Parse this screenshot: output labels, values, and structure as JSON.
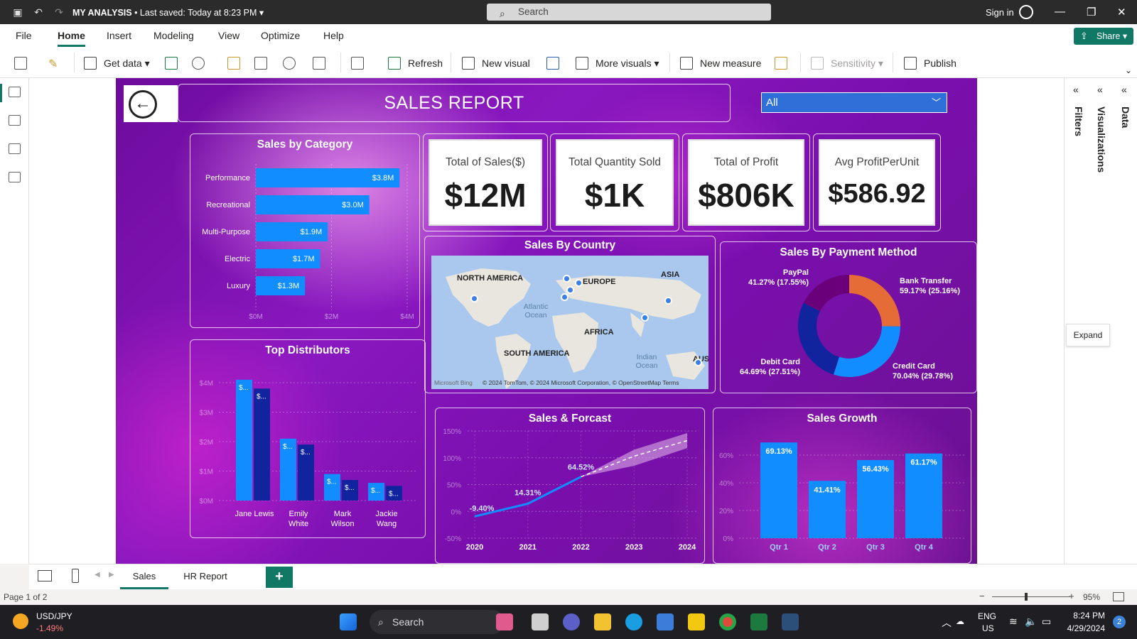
{
  "titlebar": {
    "doc_name": "MY ANALYSIS",
    "saved": "• Last saved: Today at 8:23 PM",
    "search_placeholder": "Search",
    "signin": "Sign in"
  },
  "menu": [
    "File",
    "Home",
    "Insert",
    "Modeling",
    "View",
    "Optimize",
    "Help"
  ],
  "share_label": "Share",
  "toolbar": {
    "get_data": "Get data",
    "refresh": "Refresh",
    "new_visual": "New visual",
    "more_visuals": "More visuals",
    "new_measure": "New measure",
    "sensitivity": "Sensitivity",
    "publish": "Publish"
  },
  "report": {
    "title": "SALES REPORT",
    "slicer_value": "All",
    "kpis": [
      {
        "label": "Total of Sales($)",
        "value": "$12M"
      },
      {
        "label": "Total Quantity Sold",
        "value": "$1K"
      },
      {
        "label": "Total of Profit",
        "value": "$806K"
      },
      {
        "label": "Avg ProfitPerUnit",
        "value": "$586.92"
      }
    ],
    "country_title": "Sales By Country",
    "map_labels": {
      "north_america": "NORTH AMERICA",
      "europe": "EUROPE",
      "asia": "ASIA",
      "africa": "AFRICA",
      "south_america": "SOUTH AMERICA",
      "australia": "AUS",
      "atlantic": "Atlantic Ocean",
      "indian": "Indian Ocean",
      "footer": "© 2024 TomTom, © 2024 Microsoft Corporation, © OpenStreetMap  Terms",
      "bing": "Microsoft Bing"
    }
  },
  "chart_data": [
    {
      "type": "bar",
      "title": "Sales by Category",
      "orientation": "horizontal",
      "categories": [
        "Performance",
        "Recreational",
        "Multi-Purpose",
        "Electric",
        "Luxury"
      ],
      "values": [
        3.8,
        3.0,
        1.9,
        1.7,
        1.3
      ],
      "data_labels": [
        "$3.8M",
        "$3.0M",
        "$1.9M",
        "$1.7M",
        "$1.3M"
      ],
      "xticks": [
        "$0M",
        "$2M",
        "$4M"
      ],
      "xlim": [
        0,
        4
      ],
      "color": "#118dff"
    },
    {
      "type": "bar",
      "title": "Top Distributors",
      "categories": [
        "Jane Lewis",
        "Emily White",
        "Mark Wilson",
        "Jackie Wang"
      ],
      "series": [
        {
          "values": [
            4.1,
            2.1,
            0.9,
            0.6
          ],
          "color": "#118dff"
        },
        {
          "values": [
            3.8,
            1.9,
            0.7,
            0.5
          ],
          "color": "#12239e"
        }
      ],
      "yticks": [
        "$0M",
        "$1M",
        "$2M",
        "$3M",
        "$4M"
      ],
      "ylim": [
        0,
        4
      ],
      "data_label": "$..."
    },
    {
      "type": "pie",
      "title": "Sales By Payment Method",
      "slices": [
        {
          "name": "Bank Transfer",
          "label": "59.17% (25.16%)",
          "value": 25.16,
          "color": "#e66c37"
        },
        {
          "name": "Credit Card",
          "label": "70.04% (29.78%)",
          "value": 29.78,
          "color": "#118dff"
        },
        {
          "name": "Debit Card",
          "label": "64.69% (27.51%)",
          "value": 27.51,
          "color": "#12239e"
        },
        {
          "name": "PayPal",
          "label": "41.27% (17.55%)",
          "value": 17.55,
          "color": "#6b007b"
        }
      ]
    },
    {
      "type": "line",
      "title": "Sales & Forcast",
      "x": [
        "2020",
        "2021",
        "2022",
        "2023",
        "2024"
      ],
      "values": [
        -9.4,
        14.31,
        64.52
      ],
      "data_labels": [
        "-9.40%",
        "14.31%",
        "64.52%"
      ],
      "forecast": [
        64.52,
        103,
        132
      ],
      "yticks": [
        "-50%",
        "0%",
        "50%",
        "100%",
        "150%"
      ],
      "ylim": [
        -50,
        150
      ],
      "color": "#118dff"
    },
    {
      "type": "bar",
      "title": "Sales Growth",
      "categories": [
        "Qtr 1",
        "Qtr 2",
        "Qtr 3",
        "Qtr 4"
      ],
      "values": [
        69.13,
        41.41,
        56.43,
        61.17
      ],
      "data_labels": [
        "69.13%",
        "41.41%",
        "56.43%",
        "61.17%"
      ],
      "yticks": [
        "0%",
        "20%",
        "40%",
        "60%"
      ],
      "ylim": [
        0,
        80
      ],
      "color": "#118dff"
    }
  ],
  "right_panes": {
    "filters": "Filters",
    "visualizations": "Visualizations",
    "data": "Data",
    "expand": "Expand"
  },
  "pages": {
    "tabs": [
      "Sales",
      "HR Report"
    ],
    "add": "+"
  },
  "status": {
    "page": "Page 1 of 2",
    "zoom": "95%"
  },
  "taskbar": {
    "ticker": "USD/JPY",
    "change": "-1.49%",
    "search": "Search",
    "lang1": "ENG",
    "lang2": "US",
    "time": "8:24 PM",
    "date": "4/29/2024",
    "badge": "2"
  }
}
